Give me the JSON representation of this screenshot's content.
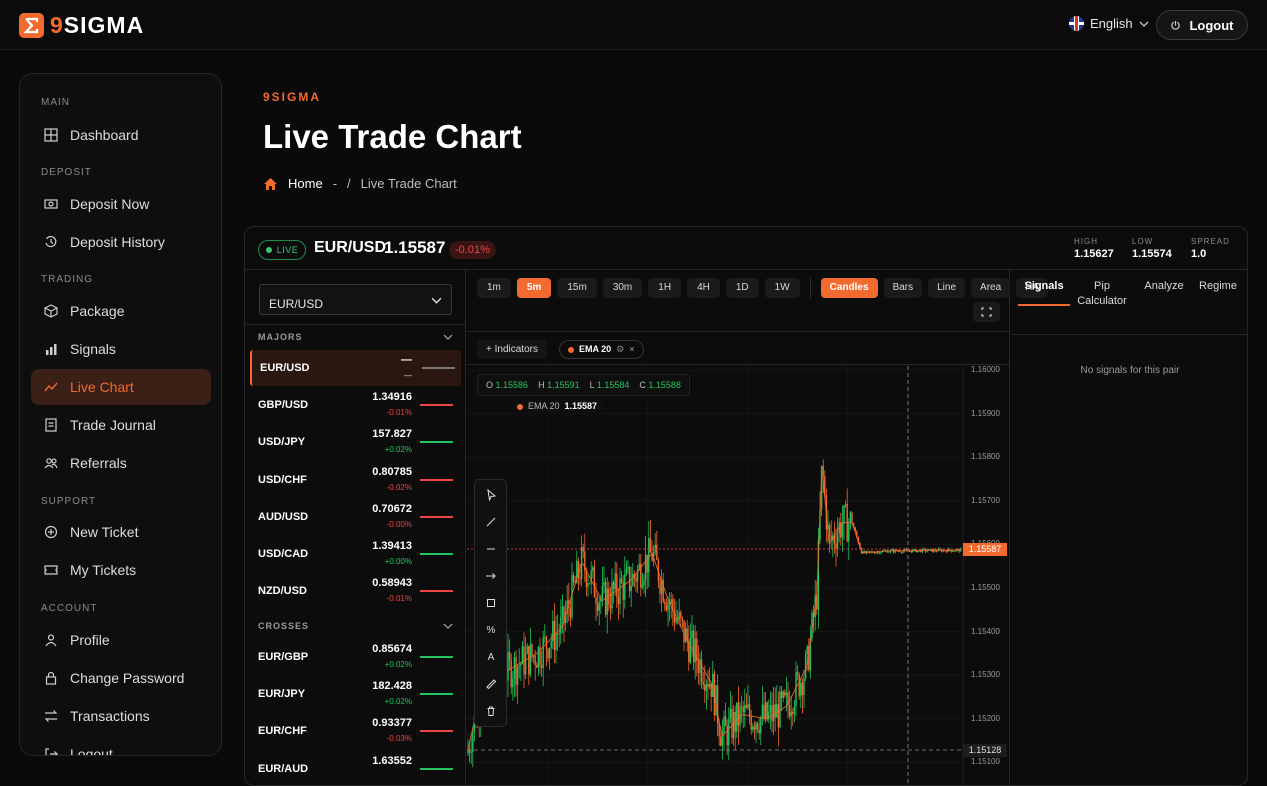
{
  "header": {
    "brand": "9SIGMA",
    "language": "English",
    "logout_label": "Logout"
  },
  "sidebar": {
    "sections": [
      {
        "label": "MAIN",
        "items": [
          {
            "label": "Dashboard",
            "icon": "grid-icon"
          }
        ]
      },
      {
        "label": "DEPOSIT",
        "items": [
          {
            "label": "Deposit Now",
            "icon": "cash-icon"
          },
          {
            "label": "Deposit History",
            "icon": "history-icon"
          }
        ]
      },
      {
        "label": "TRADING",
        "items": [
          {
            "label": "Package",
            "icon": "cube-icon"
          },
          {
            "label": "Signals",
            "icon": "bar-chart-icon"
          },
          {
            "label": "Live Chart",
            "icon": "line-chart-icon",
            "active": true
          },
          {
            "label": "Trade Journal",
            "icon": "journal-icon"
          },
          {
            "label": "Referrals",
            "icon": "users-icon"
          }
        ]
      },
      {
        "label": "SUPPORT",
        "items": [
          {
            "label": "New Ticket",
            "icon": "plus-circle-icon"
          },
          {
            "label": "My Tickets",
            "icon": "ticket-icon"
          }
        ]
      },
      {
        "label": "ACCOUNT",
        "items": [
          {
            "label": "Profile",
            "icon": "user-icon"
          },
          {
            "label": "Change Password",
            "icon": "lock-icon"
          },
          {
            "label": "Transactions",
            "icon": "transfer-icon"
          },
          {
            "label": "Logout",
            "icon": "logout-icon"
          }
        ]
      }
    ]
  },
  "page": {
    "brand_small": "9SIGMA",
    "title": "Live Trade Chart",
    "breadcrumb_home": "Home",
    "breadcrumb_sep1": "-",
    "breadcrumb_sep2": "/",
    "breadcrumb_current": "Live Trade Chart"
  },
  "ticker": {
    "live": "LIVE",
    "pair": "EUR/USD",
    "price": "1.15587",
    "change": "-0.01%",
    "high_label": "HIGH",
    "high": "1.15627",
    "low_label": "LOW",
    "low": "1.15574",
    "spread_label": "SPREAD",
    "spread": "1.0"
  },
  "pairs": {
    "select_value": "EUR/USD",
    "majors_label": "MAJORS",
    "crosses_label": "CROSSES",
    "majors": [
      {
        "name": "EUR/USD",
        "price": "—",
        "change": "—",
        "dir": "neutral",
        "active": true
      },
      {
        "name": "GBP/USD",
        "price": "1.34916",
        "change": "-0.01%",
        "dir": "down"
      },
      {
        "name": "USD/JPY",
        "price": "157.827",
        "change": "+0.02%",
        "dir": "up"
      },
      {
        "name": "USD/CHF",
        "price": "0.80785",
        "change": "-0.02%",
        "dir": "down"
      },
      {
        "name": "AUD/USD",
        "price": "0.70672",
        "change": "-0.00%",
        "dir": "down"
      },
      {
        "name": "USD/CAD",
        "price": "1.39413",
        "change": "+0.00%",
        "dir": "up"
      },
      {
        "name": "NZD/USD",
        "price": "0.58943",
        "change": "-0.01%",
        "dir": "down"
      }
    ],
    "crosses": [
      {
        "name": "EUR/GBP",
        "price": "0.85674",
        "change": "+0.02%",
        "dir": "up"
      },
      {
        "name": "EUR/JPY",
        "price": "182.428",
        "change": "+0.02%",
        "dir": "up"
      },
      {
        "name": "EUR/CHF",
        "price": "0.93377",
        "change": "-0.03%",
        "dir": "down"
      },
      {
        "name": "EUR/AUD",
        "price": "1.63552",
        "change": "",
        "dir": "up"
      }
    ]
  },
  "chart_toolbar": {
    "timeframes": [
      "1m",
      "5m",
      "15m",
      "30m",
      "1H",
      "4H",
      "1D",
      "1W"
    ],
    "active_timeframe": "5m",
    "styles": [
      "Candles",
      "Bars",
      "Line",
      "Area",
      "HA"
    ],
    "active_style": "Candles",
    "indicators_label": "Indicators",
    "ema_chip": "EMA 20"
  },
  "ohlc": {
    "o_label": "O",
    "o": "1.15586",
    "h_label": "H",
    "h": "1.15591",
    "l_label": "L",
    "l": "1.15584",
    "c_label": "C",
    "c": "1.15588"
  },
  "ema_legend": {
    "label": "EMA 20",
    "value": "1.15587"
  },
  "price_axis": [
    "1.16000",
    "1.15900",
    "1.15800",
    "1.15700",
    "1.15600",
    "1.15500",
    "1.15400",
    "1.15300",
    "1.15200",
    "1.15100"
  ],
  "price_tags": {
    "current": "1.15587",
    "crosshair": "1.15128"
  },
  "drawing_tools": [
    "cursor-icon",
    "trend-line-icon",
    "horizontal-line-icon",
    "ray-icon",
    "rectangle-icon",
    "fib-icon",
    "text-icon",
    "ruler-icon",
    "trash-icon"
  ],
  "right_panel": {
    "tabs": [
      "Signals",
      "Pip Calculator",
      "Analyze",
      "Regime"
    ],
    "active_tab": "Signals",
    "empty_text": "No signals for this pair"
  },
  "colors": {
    "accent": "#f26a2e",
    "up": "#22c55e",
    "down": "#ef4444"
  }
}
